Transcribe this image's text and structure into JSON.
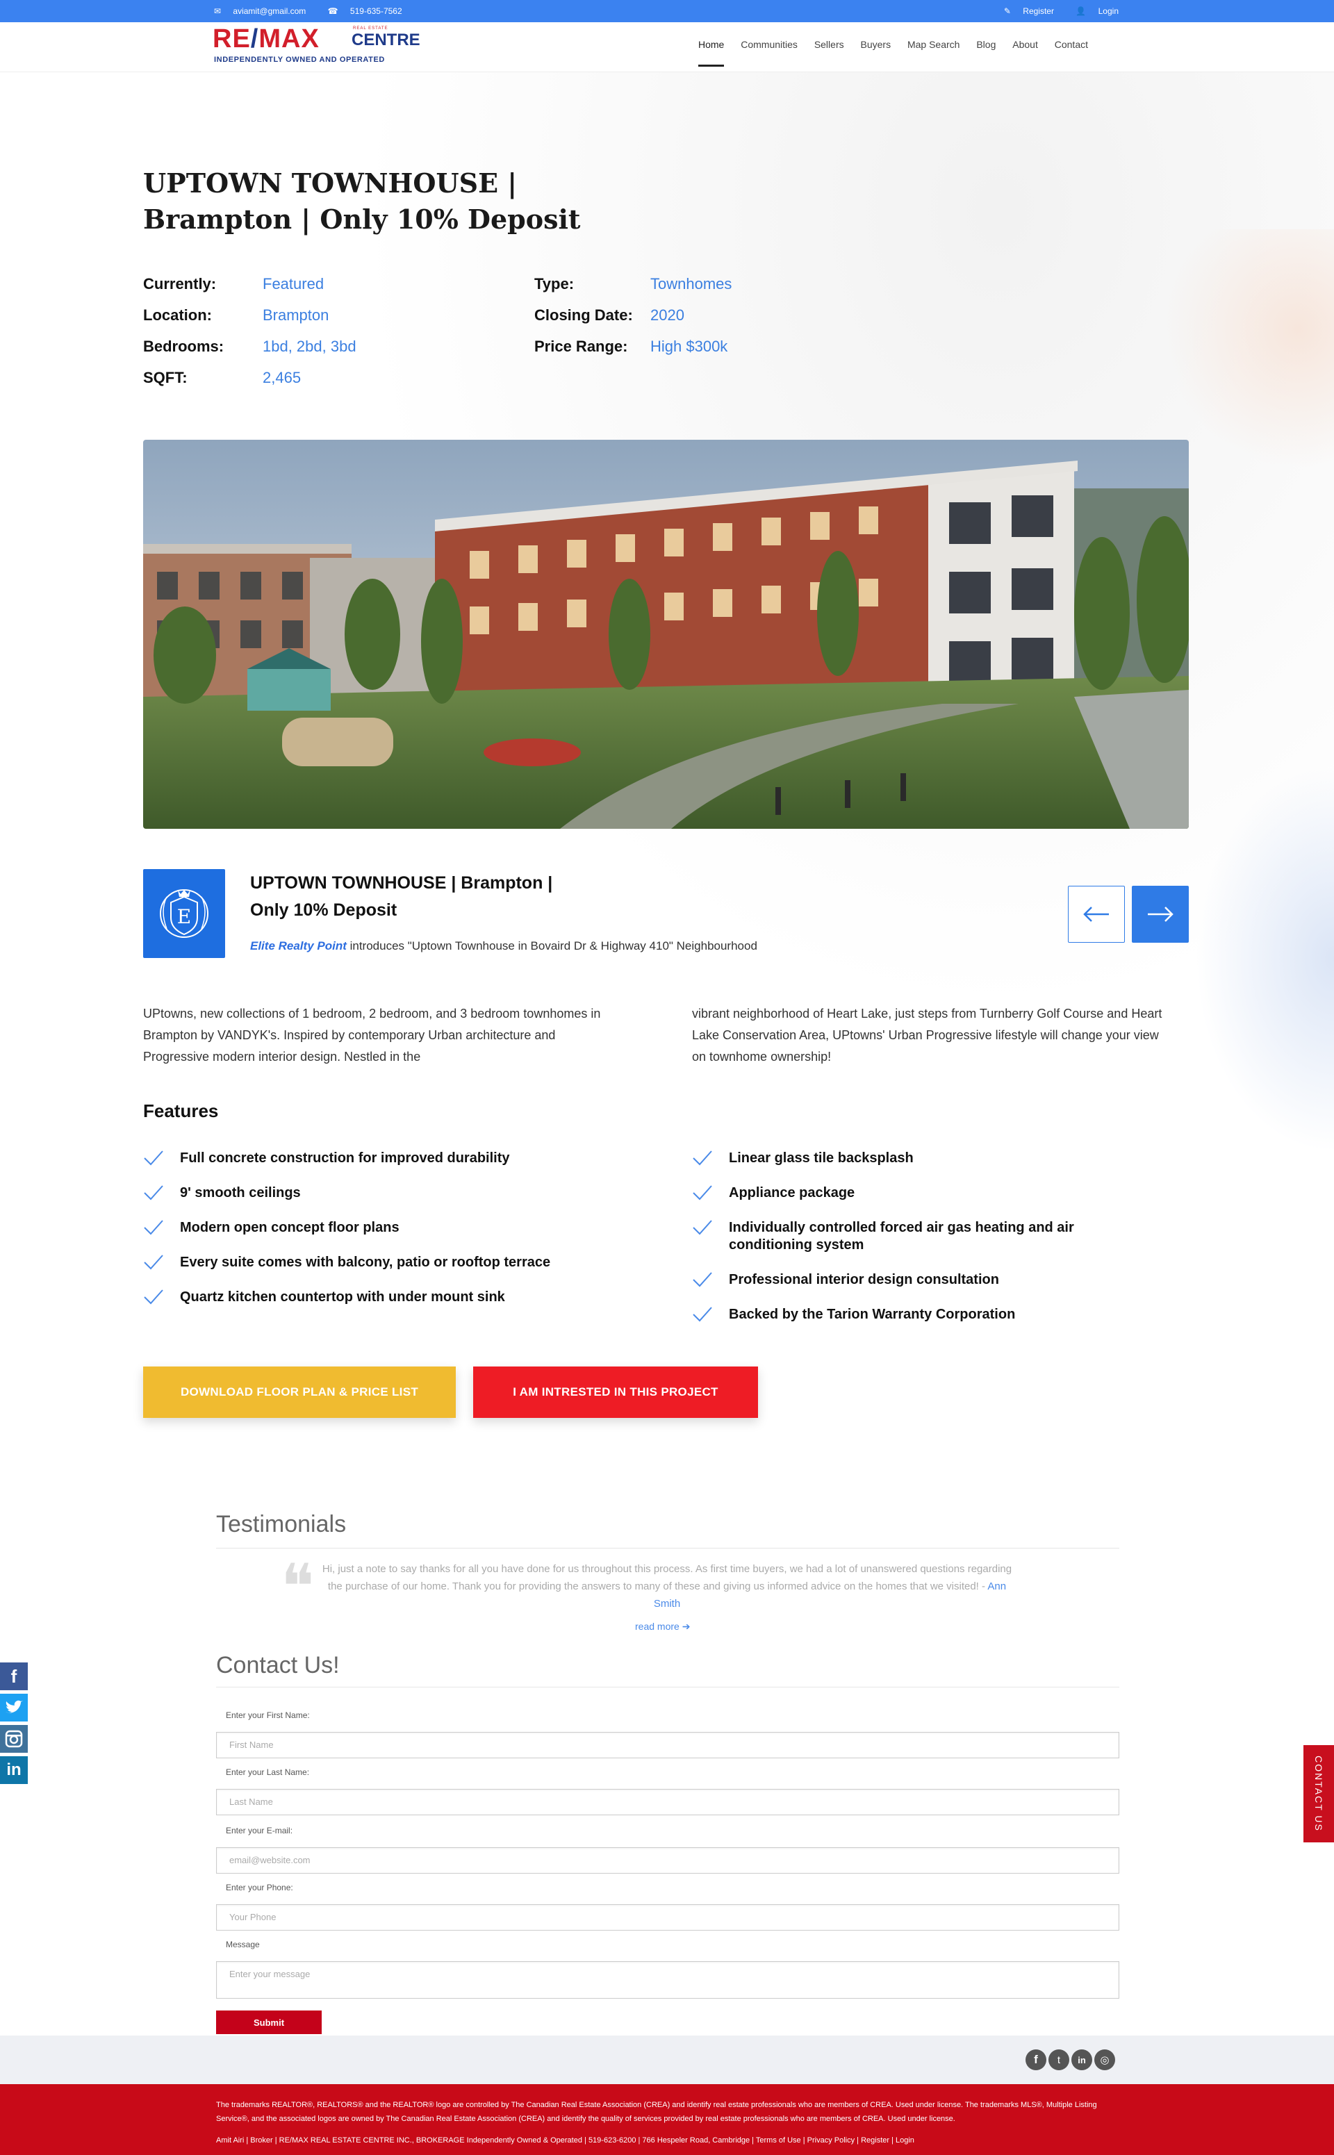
{
  "topbar": {
    "email": "aviamit@gmail.com",
    "phone": "519-635-7562",
    "register": "Register",
    "login": "Login"
  },
  "logo": {
    "re": "RE",
    "max": "MAX",
    "centre": "CENTRE",
    "realestate": "REAL ESTATE",
    "tagline": "INDEPENDENTLY OWNED AND OPERATED"
  },
  "nav": [
    "Home",
    "Communities",
    "Sellers",
    "Buyers",
    "Map Search",
    "Blog",
    "About",
    "Contact"
  ],
  "listing": {
    "title_line1": "UPTOWN TOWNHOUSE |",
    "title_line2": "Brampton | Only 10% Deposit",
    "details_left": [
      {
        "label": "Currently:",
        "value": "Featured"
      },
      {
        "label": "Location:",
        "value": "Brampton"
      },
      {
        "label": "Bedrooms:",
        "value": "1bd, 2bd, 3bd"
      },
      {
        "label": "SQFT:",
        "value": "2,465"
      }
    ],
    "details_right": [
      {
        "label": "Type:",
        "value": "Townhomes"
      },
      {
        "label": "Closing Date:",
        "value": "2020"
      },
      {
        "label": "Price Range:",
        "value": "High $300k"
      }
    ]
  },
  "intro": {
    "heading_line1": "UPTOWN TOWNHOUSE | Brampton |",
    "heading_line2": "Only 10% Deposit",
    "builder_link": "Elite Realty Point",
    "builder_text": " introduces \"Uptown Townhouse in Bovaird Dr & Highway 410\" Neighbourhood",
    "badge_letter": "E"
  },
  "description": {
    "col1": "UPtowns, new collections of 1 bedroom, 2 bedroom, and 3 bedroom townhomes in Brampton by VANDYK's. Inspired by contemporary Urban architecture and Progressive modern interior design. Nestled in the",
    "col2": "vibrant neighborhood of Heart Lake, just steps from Turnberry Golf Course and Heart Lake Conservation Area, UPtowns' Urban Progressive lifestyle will change your view on townhome ownership!"
  },
  "features": {
    "title": "Features",
    "left": [
      "Full concrete construction for improved durability",
      "9' smooth ceilings",
      "Modern open concept floor plans",
      "Every suite comes with balcony, patio or rooftop terrace",
      "Quartz kitchen countertop with under mount sink"
    ],
    "right": [
      "Linear glass tile backsplash",
      "Appliance package",
      "Individually controlled forced air gas heating and air conditioning system",
      "Professional interior design consultation",
      "Backed by the Tarion Warranty Corporation"
    ]
  },
  "buttons": {
    "download": "DOWNLOAD FLOOR PLAN & PRICE LIST",
    "interested": "I AM INTRESTED IN THIS PROJECT"
  },
  "testimonials": {
    "title": "Testimonials",
    "quote": "Hi, just a note to say thanks for all you have done for us throughout this process. As first time buyers, we had a lot of unanswered questions regarding the purchase of our home. Thank you for providing the answers to many of these and giving us informed advice on the homes that we visited! - ",
    "author": "Ann Smith",
    "read_more": "read more"
  },
  "contact": {
    "title": "Contact Us!",
    "fields": [
      {
        "label": "Enter your First Name:",
        "placeholder": "First Name"
      },
      {
        "label": "Enter your Last Name:",
        "placeholder": "Last Name"
      },
      {
        "label": "Enter your E-mail:",
        "placeholder": "email@website.com"
      },
      {
        "label": "Enter your Phone:",
        "placeholder": "Your Phone"
      }
    ],
    "message_label": "Message",
    "message_placeholder": "Enter your message",
    "submit": "Submit",
    "side_tab": "CONTACT US"
  },
  "footer": {
    "legal": "The trademarks REALTOR®, REALTORS® and the REALTOR® logo are controlled by The Canadian Real Estate Association (CREA) and identify real estate professionals who are members of CREA. Used under license. The trademarks MLS®, Multiple Listing Service®, and the associated logos are owned by The Canadian Real Estate Association (CREA) and identify the quality of services provided by real estate professionals who are members of CREA. Used under license.",
    "bottom": "Amit Airi | Broker | RE/MAX REAL ESTATE CENTRE INC., BROKERAGE Independently Owned & Operated | 519-623-6200 | 766 Hespeler Road, Cambridge | Terms of Use | Privacy Policy | Register | Login"
  },
  "colors": {
    "topbar": "#3b82f0",
    "accent_blue": "#3b7fe0",
    "brand_red": "#d21f2b",
    "brand_navy": "#1f3b8a",
    "download_yellow": "#f0bb30",
    "interest_red": "#ee1c25",
    "footer_red": "#c80a18"
  },
  "icons": [
    "envelope-icon",
    "phone-icon",
    "edit-icon",
    "user-icon",
    "arrow-left-icon",
    "arrow-right-icon",
    "check-icon",
    "quote-icon",
    "facebook-icon",
    "twitter-icon",
    "instagram-icon",
    "linkedin-icon"
  ]
}
